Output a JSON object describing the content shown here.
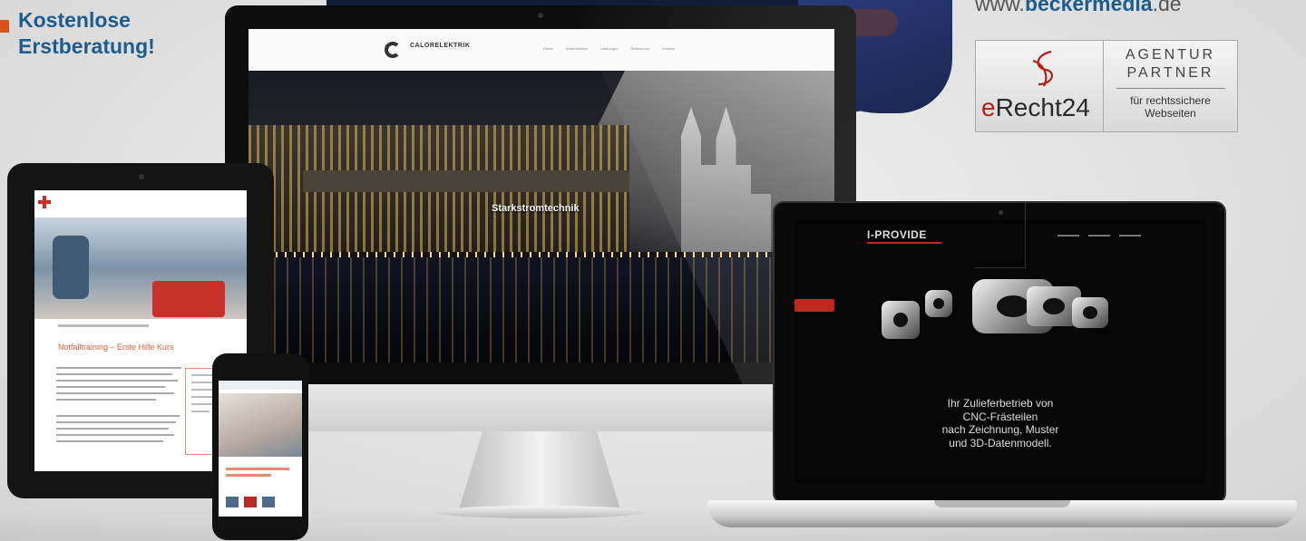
{
  "promo": {
    "lines": [
      "Kostenlose",
      "Erstberatung!"
    ],
    "text_color": "#1f5c8c",
    "bullet_color": "#d8501a"
  },
  "url": {
    "prefix": "www.",
    "brand": "beckermedia",
    "suffix": ".de"
  },
  "badge": {
    "logo_text": "eRecht24",
    "line1": "AGENTUR",
    "line2": "PARTNER",
    "line3": "für rechtssichere",
    "line4": "Webseiten",
    "accent_color": "#b3201a"
  },
  "imac": {
    "site_logo": "CALORELEKTRIK",
    "nav": [
      "Home",
      "Unternehmen",
      "Leistungen",
      "Referenzen",
      "Kontakt"
    ],
    "hero_title": "Starkstromtechnik"
  },
  "tablet": {
    "page_title": "Notfalltraining – Erste Hilfe Kurs"
  },
  "laptop": {
    "site_logo": "I-PROVIDE",
    "headline": [
      "Ihr Zulieferbetrieb von",
      "CNC-Frästeilen",
      "nach Zeichnung, Muster",
      "und 3D-Datenmodell."
    ]
  },
  "icons": {
    "badge_signature": "erecht24-signature-icon",
    "imac_logo": "calorelektrik-logo-icon",
    "tablet_logo": "red-cross-icon"
  }
}
